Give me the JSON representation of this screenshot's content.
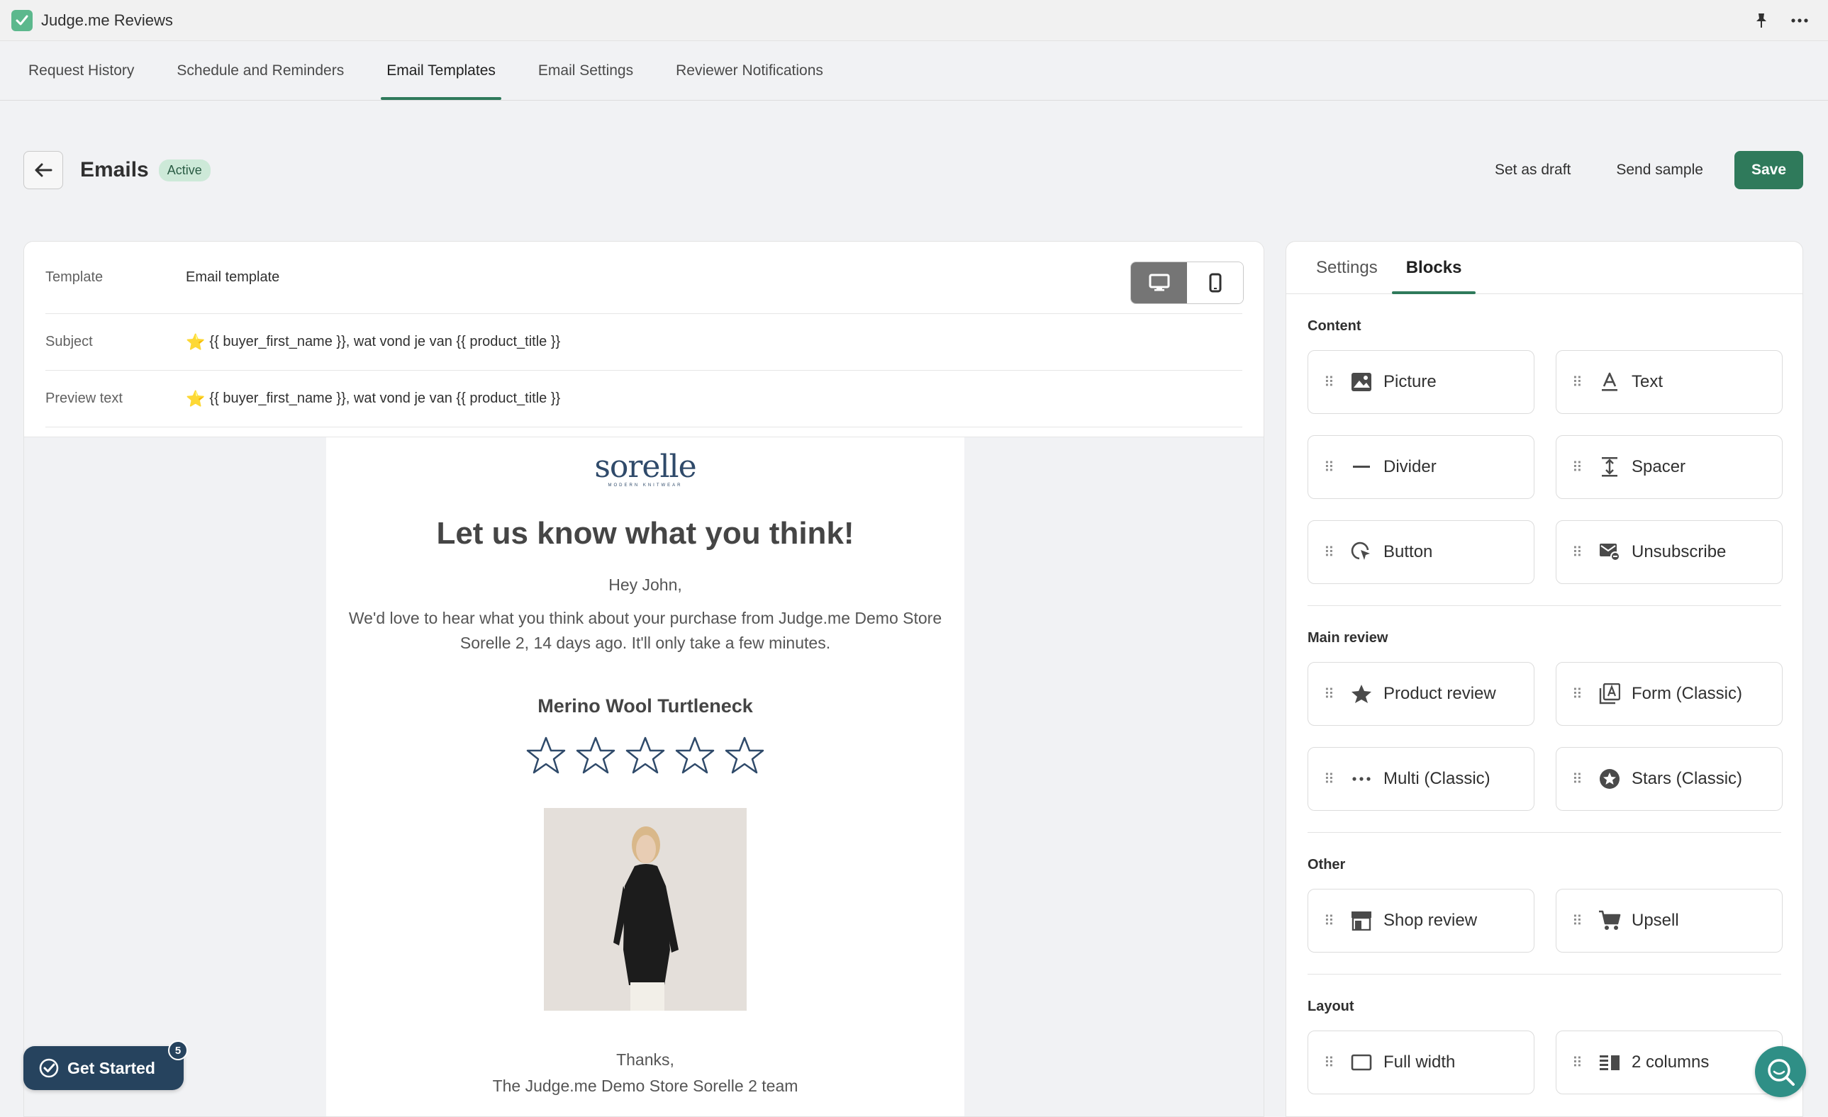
{
  "app": {
    "title": "Judge.me Reviews",
    "logo_icon": "check-logo-icon",
    "accent": "#2f7a5b"
  },
  "nav": {
    "tabs": [
      {
        "label": "Request History"
      },
      {
        "label": "Schedule and Reminders"
      },
      {
        "label": "Email Templates",
        "active": true
      },
      {
        "label": "Email Settings"
      },
      {
        "label": "Reviewer Notifications"
      }
    ]
  },
  "header": {
    "title": "Emails",
    "status": "Active",
    "actions": {
      "draft": "Set as draft",
      "sample": "Send sample",
      "save": "Save"
    }
  },
  "editor": {
    "fields": [
      {
        "label": "Template",
        "value": "Email template"
      },
      {
        "label": "Subject",
        "prefix": "⭐",
        "value": "{{ buyer_first_name }}, wat vond je van {{ product_title }}"
      },
      {
        "label": "Preview text",
        "prefix": "⭐",
        "value": "{{ buyer_first_name }}, wat vond je van {{ product_title }}"
      }
    ],
    "device": "desktop"
  },
  "email": {
    "brand": "sorelle",
    "brand_sub": "MODERN KNITWEAR",
    "heading": "Let us know what you think!",
    "greeting": "Hey John,",
    "body": "We'd love to hear what you think about your purchase from Judge.me Demo Store Sorelle 2, 14 days ago. It'll only take a few minutes.",
    "product_name": "Merino Wool Turtleneck",
    "rating_stars": 5,
    "thanks": "Thanks,",
    "signoff": "The Judge.me Demo Store Sorelle 2 team"
  },
  "panel": {
    "tabs": [
      {
        "label": "Settings"
      },
      {
        "label": "Blocks",
        "active": true
      }
    ],
    "sections": [
      {
        "title": "Content",
        "blocks": [
          {
            "label": "Picture",
            "icon": "image-icon"
          },
          {
            "label": "Text",
            "icon": "text-icon"
          },
          {
            "label": "Divider",
            "icon": "divider-icon"
          },
          {
            "label": "Spacer",
            "icon": "spacer-icon"
          },
          {
            "label": "Button",
            "icon": "button-click-icon"
          },
          {
            "label": "Unsubscribe",
            "icon": "unsubscribe-icon"
          }
        ]
      },
      {
        "title": "Main review",
        "blocks": [
          {
            "label": "Product review",
            "icon": "star-icon"
          },
          {
            "label": "Form (Classic)",
            "icon": "form-icon"
          },
          {
            "label": "Multi (Classic)",
            "icon": "dots-icon"
          },
          {
            "label": "Stars (Classic)",
            "icon": "star-circle-icon"
          }
        ]
      },
      {
        "title": "Other",
        "blocks": [
          {
            "label": "Shop review",
            "icon": "store-icon"
          },
          {
            "label": "Upsell",
            "icon": "cart-icon"
          }
        ]
      },
      {
        "title": "Layout",
        "blocks": [
          {
            "label": "Full width",
            "icon": "full-width-icon"
          },
          {
            "label": "2 columns",
            "icon": "two-columns-icon"
          }
        ]
      }
    ]
  },
  "floating": {
    "get_started": "Get Started",
    "get_started_count": "5"
  }
}
